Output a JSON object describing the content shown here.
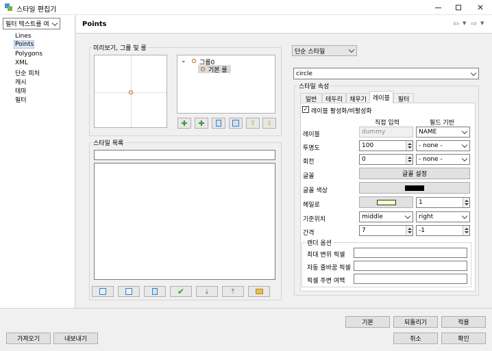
{
  "window": {
    "title": "스타일 편집기",
    "nav": {
      "back": "⇦",
      "forward": "⇨"
    }
  },
  "sidebar": {
    "filter_value": "필터 텍스트를 여",
    "items": [
      "Lines",
      "Points",
      "Polygons",
      "XML",
      "단순 피처",
      "캐시",
      "테마",
      "필터"
    ],
    "selected": "Points"
  },
  "page": {
    "title": "Points"
  },
  "preview": {
    "group_label": "미리보기, 그룹 및 룰",
    "tree_group": "그룹0",
    "tree_rule": "기본 룰"
  },
  "style_list": {
    "label": "스타일 목록",
    "filter_value": ""
  },
  "style_type": {
    "value": "단순 스타일"
  },
  "symbol": {
    "value": "circle"
  },
  "props": {
    "label": "스타일 속성",
    "tabs": [
      "일반",
      "테두리",
      "채우기",
      "레이블",
      "필터"
    ],
    "active_tab": "레이블",
    "enable_label": "레이블 활성화/비활성화",
    "col_direct": "직접 입력",
    "col_field": "필드 기반",
    "rows": {
      "label": {
        "name": "레이블",
        "direct": "dummy",
        "field": "NAME"
      },
      "opacity": {
        "name": "투명도",
        "direct": "100",
        "field": "- none -"
      },
      "rotation": {
        "name": "회전",
        "direct": "0",
        "field": "- none -"
      },
      "font": {
        "name": "글꼴",
        "button": "글꼴 설정"
      },
      "font_color": {
        "name": "글꼴 색상",
        "color": "#000000"
      },
      "halo": {
        "name": "헤일로",
        "color": "#ffffcc",
        "value": "1"
      },
      "anchor": {
        "name": "기준위치",
        "h": "middle",
        "v": "right"
      },
      "spacing": {
        "name": "간격",
        "x": "7",
        "y": "-1"
      }
    },
    "render": {
      "label": "렌더 옵션",
      "max_disp": "최대 변위 픽셀",
      "auto_wrap": "자동 줄바꿈 픽셀",
      "pixel_margin": "픽셀 주변 여백"
    }
  },
  "footer": {
    "import": "가져오기",
    "export": "내보내기",
    "default": "기본",
    "revert": "되돌리기",
    "apply": "적용",
    "cancel": "취소",
    "ok": "확인"
  }
}
